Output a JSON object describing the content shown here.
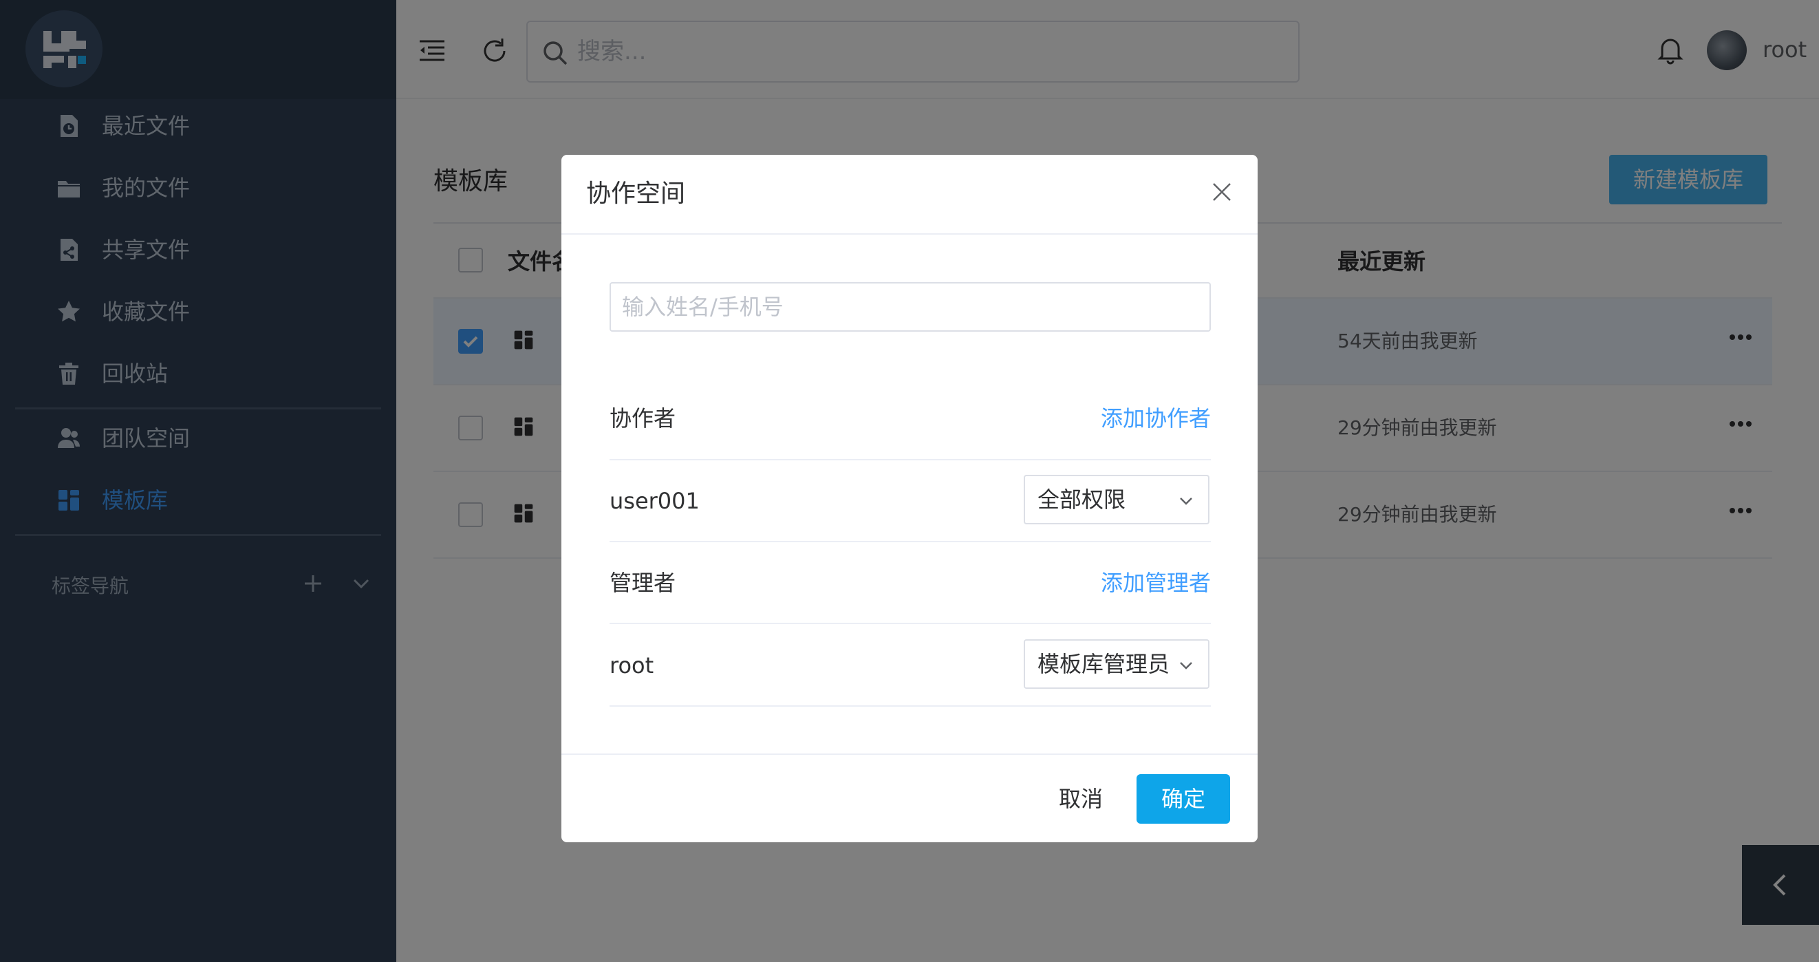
{
  "sidebar": {
    "items": [
      {
        "label": "最近文件",
        "icon": "recent-file-icon"
      },
      {
        "label": "我的文件",
        "icon": "folder-icon"
      },
      {
        "label": "共享文件",
        "icon": "share-file-icon"
      },
      {
        "label": "收藏文件",
        "icon": "star-icon"
      },
      {
        "label": "回收站",
        "icon": "trash-icon"
      },
      {
        "label": "团队空间",
        "icon": "team-icon"
      },
      {
        "label": "模板库",
        "icon": "template-icon",
        "active": true
      }
    ],
    "tags_label": "标签导航"
  },
  "topbar": {
    "search_placeholder": "搜索...",
    "username": "root"
  },
  "content": {
    "title": "模板库",
    "new_button": "新建模板库",
    "columns": {
      "name": "文件名",
      "updated": "最近更新"
    },
    "rows": [
      {
        "updated": "54天前由我更新",
        "checked": true
      },
      {
        "updated": "29分钟前由我更新",
        "checked": false
      },
      {
        "updated": "29分钟前由我更新",
        "checked": false
      }
    ]
  },
  "dialog": {
    "title": "协作空间",
    "input_placeholder": "输入姓名/手机号",
    "collaborators_label": "协作者",
    "add_collaborator": "添加协作者",
    "collaborator": {
      "name": "user001",
      "permission": "全部权限"
    },
    "managers_label": "管理者",
    "add_manager": "添加管理者",
    "manager": {
      "name": "root",
      "role": "模板库管理员"
    },
    "cancel": "取消",
    "confirm": "确定"
  },
  "colors": {
    "sidebar_bg": "#304156",
    "accent": "#409eff",
    "primary_button": "#0ea5e9"
  }
}
